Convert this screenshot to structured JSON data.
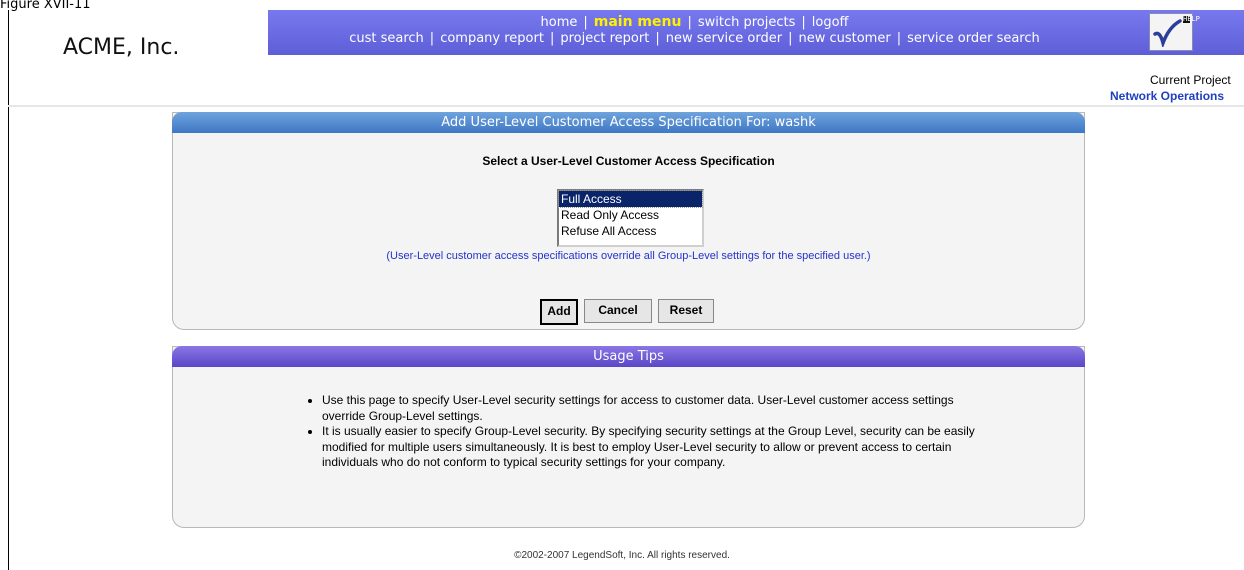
{
  "figure_caption": "Figure XVII-11",
  "app": {
    "logo": "ACME, Inc.",
    "help_label": "HELP"
  },
  "nav": {
    "row1": [
      "home",
      "main menu",
      "switch projects",
      "logoff"
    ],
    "row2": [
      "cust search",
      "company report",
      "project report",
      "new service order",
      "new customer",
      "service order search"
    ],
    "active": "main menu",
    "separator": "|"
  },
  "current_project": {
    "label": "Current Project",
    "name": "Network Operations"
  },
  "access_panel": {
    "header": "Add User-Level Customer Access Specification For:  washk",
    "title": "Select a User-Level Customer Access Specification",
    "options": [
      "Full Access",
      "Read Only Access",
      "Refuse All Access"
    ],
    "selected": "Full Access",
    "note": "(User-Level customer access specifications override all Group-Level settings for the specified user.)",
    "buttons": {
      "add": "Add",
      "cancel": "Cancel",
      "reset": "Reset"
    }
  },
  "tips_panel": {
    "header": "Usage Tips",
    "tips": [
      "Use this page to specify User-Level security settings for access to customer data.   User-Level customer access settings override Group-Level settings.",
      "It is usually easier to specify Group-Level security.  By specifying security settings at the Group Level, security can be easily modified for multiple users simultaneously.  It is best to employ User-Level security to allow or prevent access to certain individuals who do not conform to typical security settings for your company."
    ]
  },
  "footer": "©2002-2007 LegendSoft, Inc. All rights reserved.",
  "colors": {
    "nav_bg": "#6C6CE0",
    "active_nav": "#FFF200",
    "header_blue": "#3E78C4",
    "header_purple": "#5B46C8",
    "link_blue": "#2040C0"
  }
}
